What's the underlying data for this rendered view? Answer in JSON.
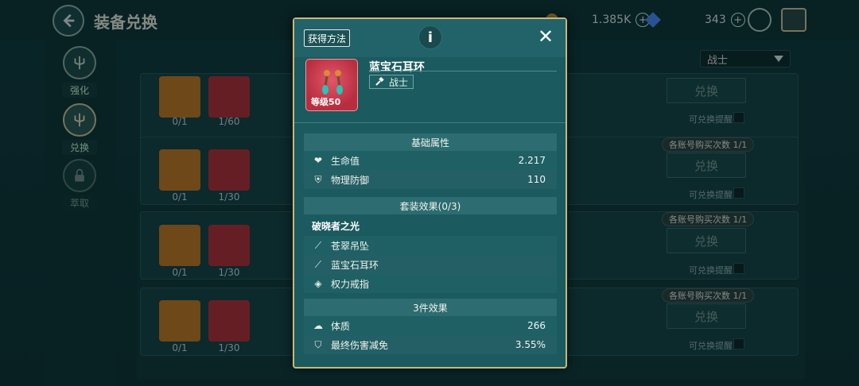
{
  "header": {
    "title": "装备兑换",
    "gold_amount": "1.385K",
    "gem_amount": "343"
  },
  "sidebar": {
    "items": [
      {
        "label": "强化"
      },
      {
        "label": "兑换"
      },
      {
        "label": "萃取"
      }
    ]
  },
  "filter": {
    "selected_class": "战士"
  },
  "rows": [
    {
      "have": "0/1",
      "material": "1/60",
      "button": "兑换",
      "remind": "可兑换提醒",
      "limit": ""
    },
    {
      "have": "0/1",
      "material": "1/30",
      "button": "兑换",
      "remind": "可兑换提醒",
      "limit": "各账号购买次数 1/1"
    },
    {
      "have": "0/1",
      "material": "1/30",
      "button": "兑换",
      "remind": "可兑换提醒",
      "limit": "各账号购买次数 1/1"
    },
    {
      "have": "0/1",
      "material": "1/30",
      "button": "兑换",
      "remind": "可兑换提醒",
      "limit": "各账号购买次数 1/1"
    }
  ],
  "modal": {
    "howto_label": "获得方法",
    "item_name": "蓝宝石耳环",
    "item_level": "等级50",
    "item_class": "战士",
    "base_stats_title": "基础属性",
    "base_stats": [
      {
        "icon": "heart-icon",
        "label": "生命值",
        "value": "2.217"
      },
      {
        "icon": "shield-icon",
        "label": "物理防御",
        "value": "110"
      }
    ],
    "set_title": "套装效果(0/3)",
    "set_name": "破晓者之光",
    "set_items": [
      {
        "icon": "pendant-icon",
        "label": "苍翠吊坠"
      },
      {
        "icon": "earring-icon",
        "label": "蓝宝石耳环"
      },
      {
        "icon": "ring-icon",
        "label": "权力戒指"
      }
    ],
    "bonus_title": "3件效果",
    "bonus_stats": [
      {
        "icon": "constitution-icon",
        "label": "体质",
        "value": "266"
      },
      {
        "icon": "damage-reduction-icon",
        "label": "最终伤害减免",
        "value": "3.55%"
      }
    ]
  }
}
